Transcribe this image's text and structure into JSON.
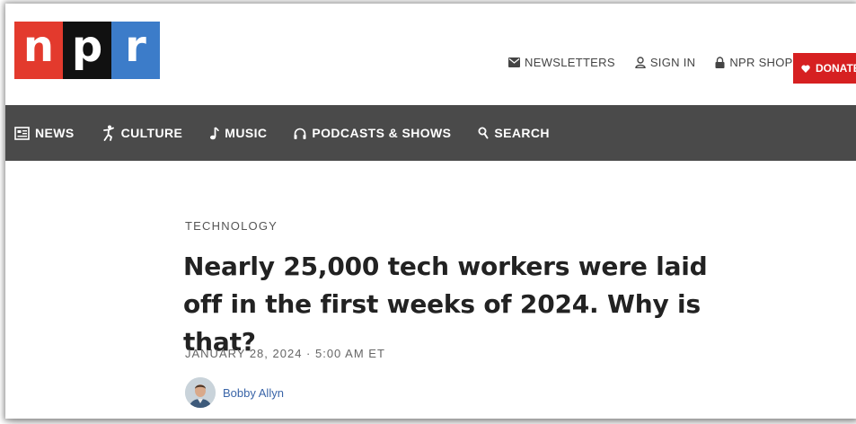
{
  "header": {
    "logo": {
      "letters": [
        "n",
        "p",
        "r"
      ],
      "colors": [
        "#e33a2d",
        "#111111",
        "#3c7cc9"
      ]
    },
    "links": [
      {
        "label": "NEWSLETTERS",
        "icon": "envelope-icon"
      },
      {
        "label": "SIGN IN",
        "icon": "user-icon"
      },
      {
        "label": "NPR SHOP",
        "icon": "lock-icon"
      }
    ],
    "donate": {
      "label": "DONATE",
      "icon": "heart-icon",
      "color": "#d62021"
    }
  },
  "nav": {
    "background": "#4a4a4a",
    "items": [
      {
        "label": "NEWS",
        "icon": "news-icon"
      },
      {
        "label": "CULTURE",
        "icon": "culture-icon"
      },
      {
        "label": "MUSIC",
        "icon": "music-note-icon"
      },
      {
        "label": "PODCASTS & SHOWS",
        "icon": "headphones-icon"
      },
      {
        "label": "SEARCH",
        "icon": "search-icon"
      }
    ]
  },
  "article": {
    "category": "TECHNOLOGY",
    "headline": "Nearly 25,000 tech workers were laid off in the first weeks of 2024. Why is that?",
    "date": "JANUARY 28, 2024 · 5:00 AM ET",
    "author": "Bobby Allyn"
  }
}
